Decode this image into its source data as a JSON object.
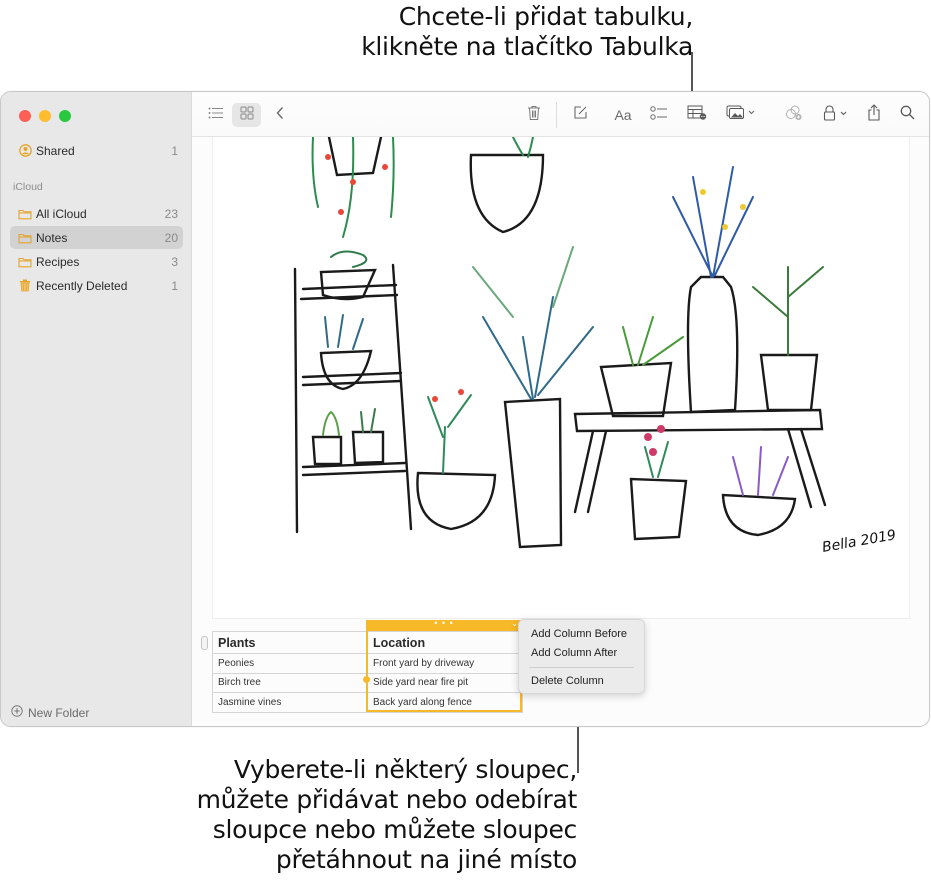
{
  "callouts": {
    "top": [
      "Chcete-li přidat tabulku,",
      "klikněte na tlačítko Tabulka"
    ],
    "bottom": [
      "Vyberete-li některý sloupec,",
      "můžete přidávat nebo odebírat",
      "sloupce nebo můžete sloupec",
      "přetáhnout na jiné místo"
    ]
  },
  "window": {
    "traffic_lights": [
      "close",
      "minimize",
      "zoom"
    ]
  },
  "sidebar": {
    "shared": {
      "label": "Shared",
      "count": "1",
      "icon": "person-circle-icon"
    },
    "section_label": "iCloud",
    "items": [
      {
        "label": "All iCloud",
        "count": "23",
        "icon": "folder-icon",
        "selected": false
      },
      {
        "label": "Notes",
        "count": "20",
        "icon": "folder-icon",
        "selected": true
      },
      {
        "label": "Recipes",
        "count": "3",
        "icon": "folder-icon",
        "selected": false
      },
      {
        "label": "Recently Deleted",
        "count": "1",
        "icon": "trash-icon",
        "selected": false
      }
    ],
    "new_folder": "New Folder"
  },
  "toolbar": {
    "buttons": [
      {
        "name": "list-view",
        "icon": "list-icon"
      },
      {
        "name": "gallery-view",
        "icon": "grid-icon",
        "active": true
      },
      {
        "name": "back",
        "icon": "chevron-left-icon"
      },
      {
        "name": "delete",
        "icon": "trash-icon"
      },
      {
        "name": "compose",
        "icon": "compose-icon"
      },
      {
        "name": "format",
        "icon": "text-format-icon",
        "label": "Aa"
      },
      {
        "name": "checklist",
        "icon": "checklist-icon"
      },
      {
        "name": "table",
        "icon": "table-icon"
      },
      {
        "name": "media",
        "icon": "photo-icon"
      },
      {
        "name": "collaborate",
        "icon": "collaborate-icon",
        "disabled": true
      },
      {
        "name": "lock",
        "icon": "lock-icon"
      },
      {
        "name": "share",
        "icon": "share-icon"
      },
      {
        "name": "search",
        "icon": "search-icon"
      }
    ]
  },
  "note": {
    "drawing": {
      "description": "Hand-drawn illustration of potted plants on a ladder shelf and bench",
      "signature": "Bella 2019"
    },
    "table": {
      "headers": [
        "Plants",
        "Location"
      ],
      "rows": [
        [
          "Peonies",
          "Front yard by driveway"
        ],
        [
          "Birch tree",
          "Side yard near fire pit"
        ],
        [
          "Jasmine vines",
          "Back yard along fence"
        ]
      ],
      "selected_column": 1,
      "column_handle": "• • •"
    },
    "context_menu": {
      "items": [
        "Add Column Before",
        "Add Column After"
      ],
      "destructive": [
        "Delete Column"
      ]
    }
  },
  "colors": {
    "accent": "#f7b928",
    "sidebar_bg": "#e8e8e8",
    "selected_row": "#d2d2d2",
    "folder_icon": "#e5a52c"
  }
}
